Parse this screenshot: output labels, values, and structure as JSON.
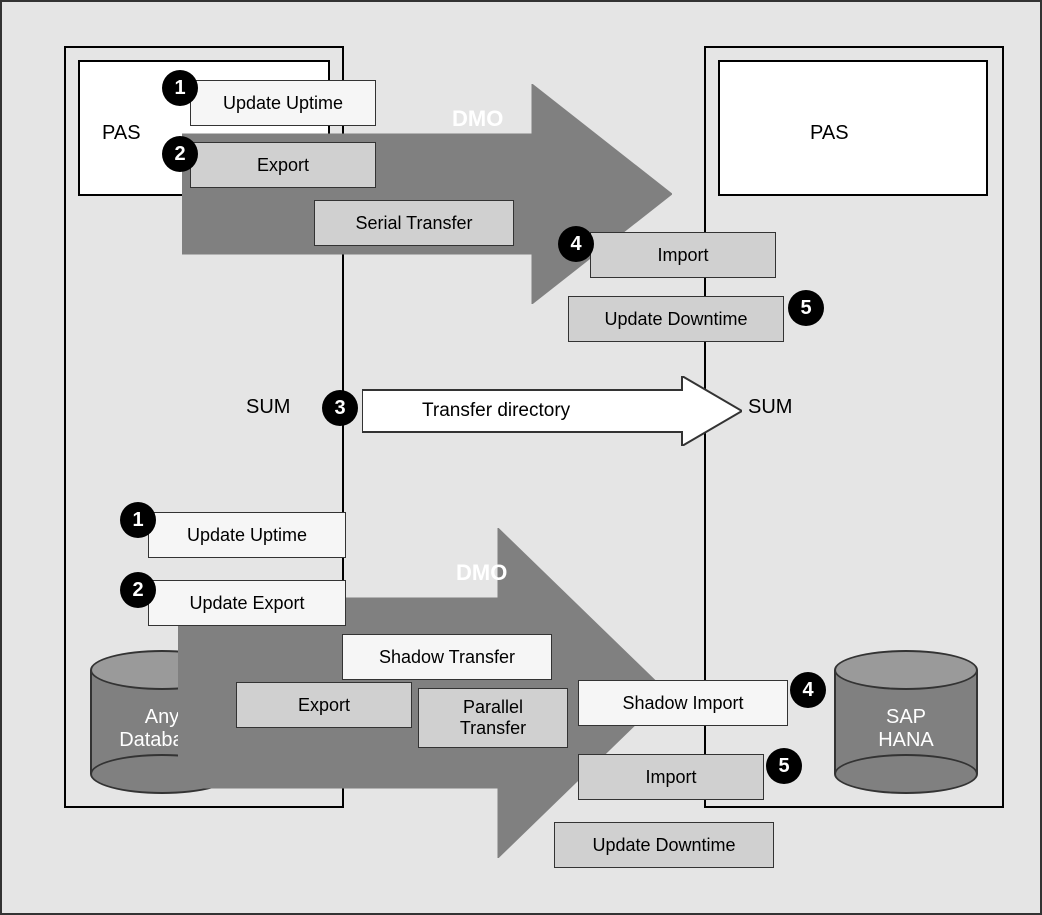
{
  "left": {
    "pas": "PAS",
    "sum": "SUM",
    "db": "Any\nDatabase"
  },
  "right": {
    "pas": "PAS",
    "sum": "SUM",
    "db": "SAP\nHANA"
  },
  "top": {
    "dmo": "DMO",
    "step1": "Update Uptime",
    "step2": "Export",
    "serial": "Serial Transfer",
    "step4": "Import",
    "step5": "Update Downtime"
  },
  "middle": {
    "transfer": "Transfer directory"
  },
  "bottom": {
    "dmo": "DMO",
    "step1": "Update Uptime",
    "step2": "Update Export",
    "export": "Export",
    "shadowTransfer": "Shadow Transfer",
    "parallelTransfer": "Parallel\nTransfer",
    "step4": "Shadow Import",
    "step5": "Import",
    "downtime": "Update Downtime"
  },
  "badges": {
    "n1": "1",
    "n2": "2",
    "n3": "3",
    "n4": "4",
    "n5": "5"
  }
}
